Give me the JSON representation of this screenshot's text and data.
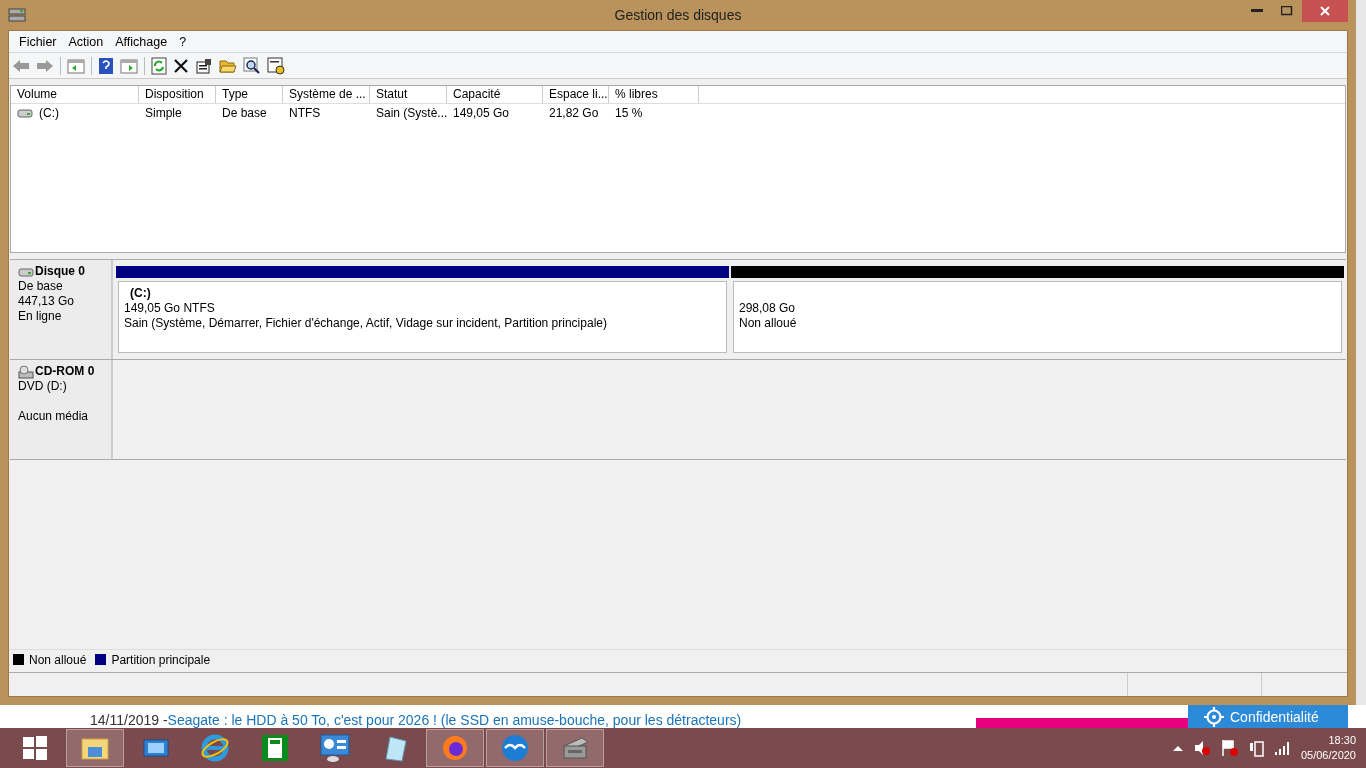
{
  "window": {
    "title": "Gestion des disques"
  },
  "menu": [
    "Fichier",
    "Action",
    "Affichage",
    "?"
  ],
  "table": {
    "columns": [
      "Volume",
      "Disposition",
      "Type",
      "Système de ...",
      "Statut",
      "Capacité",
      "Espace li...",
      "% libres"
    ],
    "rows": [
      {
        "cells": [
          "(C:)",
          "Simple",
          "De base",
          "NTFS",
          "Sain (Systè...",
          "149,05 Go",
          "21,82 Go",
          "15 %"
        ]
      }
    ]
  },
  "disks": [
    {
      "kind": "disk",
      "name": "Disque 0",
      "lines": [
        "De base",
        "447,13 Go",
        "En ligne"
      ],
      "partitions": [
        {
          "kind": "primary",
          "color": "#000080",
          "label": "(C:)",
          "size": "149,05 Go NTFS",
          "status": "Sain (Système, Démarrer, Fichier d'échange, Actif, Vidage sur incident, Partition principale)"
        },
        {
          "kind": "unallocated",
          "color": "#000000",
          "size": "298,08 Go",
          "status": "Non alloué"
        }
      ]
    },
    {
      "kind": "cdrom",
      "name": "CD-ROM 0",
      "lines": [
        "DVD (D:)",
        "Aucun média"
      ]
    }
  ],
  "legend": [
    {
      "label": "Non alloué",
      "color": "#000000"
    },
    {
      "label": "Partition principale",
      "color": "#000080"
    }
  ],
  "webpage": {
    "date": "14/11/2019 - ",
    "link": "Seagate : le HDD à 50 To, c'est pour 2026 ! (le SSD en amuse-bouche, pour les détracteurs)",
    "privacy": "Confidentialité"
  },
  "taskbar": {
    "apps": [
      {
        "kind": "explorer",
        "running": true
      },
      {
        "kind": "screen",
        "running": false
      },
      {
        "kind": "ie",
        "running": false
      },
      {
        "kind": "calculator",
        "running": false
      },
      {
        "kind": "panel",
        "running": false
      },
      {
        "kind": "notepad",
        "running": false
      },
      {
        "kind": "firefox",
        "running": true
      },
      {
        "kind": "office",
        "running": true
      },
      {
        "kind": "diskmgmt",
        "running": true
      }
    ],
    "time": "18:30",
    "date": "05/06/2020"
  }
}
